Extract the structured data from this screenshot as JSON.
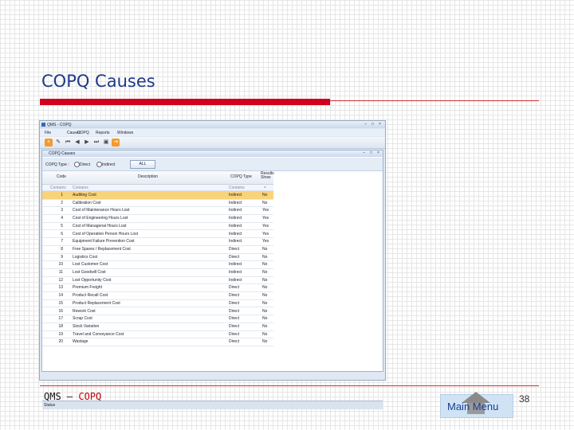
{
  "slide": {
    "title": "COPQ Causes",
    "footer_left_a": "QMS – ",
    "footer_left_b": "COPQ",
    "main_menu": "Main Menu",
    "page_number": "38"
  },
  "app": {
    "title": "QMS - COPQ",
    "menu": [
      "File",
      "Causes",
      "COPQ",
      "Reports",
      "Windows"
    ],
    "child_title": "COPQ Causes",
    "filter": {
      "label": "COPQ Type :",
      "options": [
        "Direct",
        "Indirect"
      ],
      "all_button": "ALL"
    },
    "columns": {
      "code": "Code",
      "description": "Description",
      "type": "COPQ Type",
      "positive": "Results Show"
    },
    "filter_row": {
      "code": "Contains",
      "description": "Contains",
      "type": "Contains",
      "positive": "="
    },
    "rows": [
      {
        "code": "1",
        "description": "Auditing Cost",
        "type": "Indirect",
        "positive": "No"
      },
      {
        "code": "2",
        "description": "Calibration Cost",
        "type": "Indirect",
        "positive": "No"
      },
      {
        "code": "3",
        "description": "Cost of Maintenance Hours Lost",
        "type": "Indirect",
        "positive": "Yes"
      },
      {
        "code": "4",
        "description": "Cost of Engineering Hours Lost",
        "type": "Indirect",
        "positive": "Yes"
      },
      {
        "code": "5",
        "description": "Cost of Managerial Hours Lost",
        "type": "Indirect",
        "positive": "Yes"
      },
      {
        "code": "6",
        "description": "Cost of Operation Person Hours Lost",
        "type": "Indirect",
        "positive": "Yes"
      },
      {
        "code": "7",
        "description": "Equipment Failure Prevention Cost",
        "type": "Indirect",
        "positive": "Yes"
      },
      {
        "code": "8",
        "description": "Free Spares / Replacement Cost",
        "type": "Direct",
        "positive": "No"
      },
      {
        "code": "9",
        "description": "Logistics Cost",
        "type": "Direct",
        "positive": "No"
      },
      {
        "code": "10",
        "description": "Lost Customer Cost",
        "type": "Indirect",
        "positive": "No"
      },
      {
        "code": "11",
        "description": "Lost Goodwill Cost",
        "type": "Indirect",
        "positive": "No"
      },
      {
        "code": "12",
        "description": "Lost Opportunity Cost",
        "type": "Indirect",
        "positive": "No"
      },
      {
        "code": "13",
        "description": "Premium Freight",
        "type": "Direct",
        "positive": "No"
      },
      {
        "code": "14",
        "description": "Product Recall Cost",
        "type": "Direct",
        "positive": "No"
      },
      {
        "code": "15",
        "description": "Product Replacement Cost",
        "type": "Direct",
        "positive": "No"
      },
      {
        "code": "16",
        "description": "Rework Cost",
        "type": "Direct",
        "positive": "No"
      },
      {
        "code": "17",
        "description": "Scrap Cost",
        "type": "Direct",
        "positive": "No"
      },
      {
        "code": "18",
        "description": "Stock Variation",
        "type": "Direct",
        "positive": "No"
      },
      {
        "code": "19",
        "description": "Travel and Conveyance Cost",
        "type": "Direct",
        "positive": "No"
      },
      {
        "code": "20",
        "description": "Wastage",
        "type": "Direct",
        "positive": "No"
      }
    ],
    "status": "Status"
  },
  "colors": {
    "title": "#1d3a8a",
    "accent_bar": "#d0021b",
    "selected_row": "#f9d37a"
  }
}
